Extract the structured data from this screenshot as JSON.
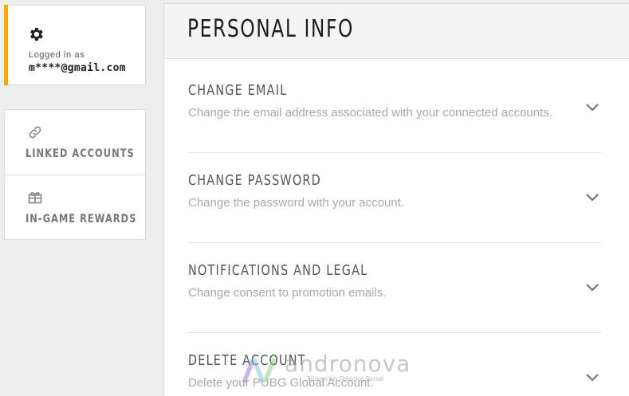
{
  "account": {
    "logged_in_label": "Logged in as",
    "email": "m****@gmail.com",
    "icon": "gear-icon",
    "accent_color": "#f2a900"
  },
  "sidebar": {
    "items": [
      {
        "label": "LINKED ACCOUNTS",
        "icon": "link-icon"
      },
      {
        "label": "IN-GAME REWARDS",
        "icon": "gift-icon"
      }
    ]
  },
  "main": {
    "title": "PERSONAL INFO",
    "sections": [
      {
        "title": "CHANGE EMAIL",
        "description": "Change the email address associated with your connected accounts.",
        "icon": "chevron-down-icon"
      },
      {
        "title": "CHANGE PASSWORD",
        "description": "Change the password with your account.",
        "icon": "chevron-down-icon"
      },
      {
        "title": "NOTIFICATIONS AND LEGAL",
        "description": "Change consent to promotion emails.",
        "icon": "chevron-down-icon"
      },
      {
        "title": "DELETE ACCOUNT",
        "description": "Delete your PUBG Global Account.",
        "icon": "chevron-down-icon"
      }
    ]
  },
  "watermark": {
    "brand": "andronova",
    "tagline": "Türkiye'nin Teknoloji Portalı"
  }
}
